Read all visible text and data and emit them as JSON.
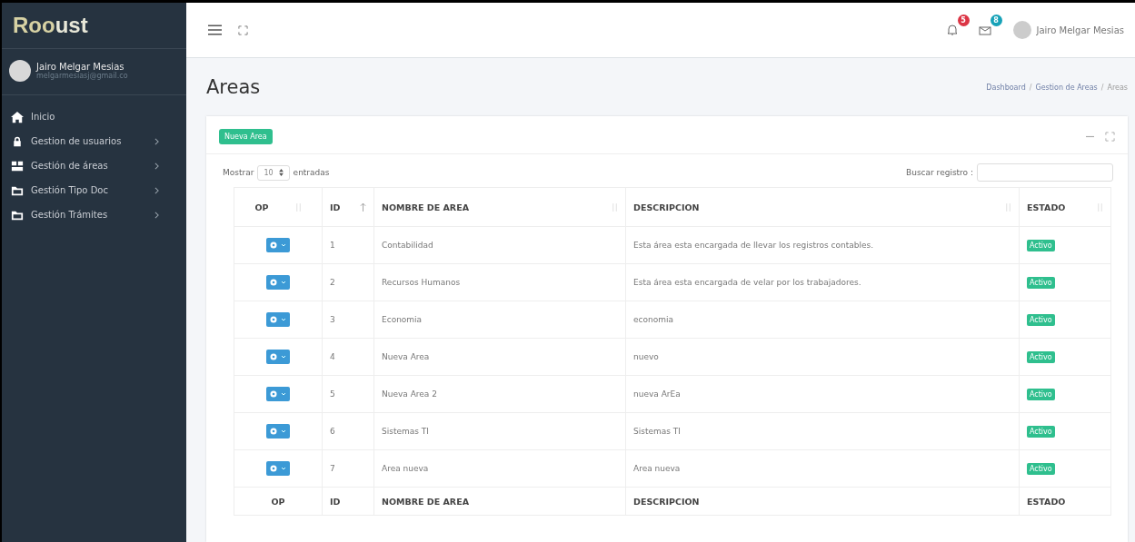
{
  "brand": {
    "logo": "Roo",
    "logo_end": "ust"
  },
  "user": {
    "name": "Jairo Melgar Mesias",
    "email": "melgarmesiasj@gmail.co"
  },
  "sidebar": {
    "items": [
      {
        "label": "Inicio",
        "kind": "home",
        "has_children": false
      },
      {
        "label": "Gestion de usuarios",
        "kind": "lock",
        "has_children": true
      },
      {
        "label": "Gestión de áreas",
        "kind": "boxes",
        "has_children": true
      },
      {
        "label": "Gestión Tipo Doc",
        "kind": "folder",
        "has_children": true
      },
      {
        "label": "Gestión Trámites",
        "kind": "folder",
        "has_children": true
      }
    ]
  },
  "topbar": {
    "notifications": {
      "count": "5",
      "color": "#dc3545"
    },
    "messages": {
      "count": "8",
      "color": "#17a2b8"
    },
    "user_name": "Jairo Melgar Mesias"
  },
  "page": {
    "title": "Areas",
    "breadcrumb": [
      {
        "label": "Dashboard",
        "kind": "link"
      },
      {
        "label": "/",
        "kind": "separator"
      },
      {
        "label": "Gestion de Areas",
        "kind": "link"
      },
      {
        "label": "/",
        "kind": "separator"
      },
      {
        "label": "Areas",
        "kind": "current"
      }
    ]
  },
  "card": {
    "new_button": "Nueva Area",
    "show_label": "Mostrar",
    "page_size": "10",
    "entries_label": "entradas",
    "search_label": "Buscar registro :"
  },
  "table": {
    "columns": [
      {
        "label": "OP",
        "kind": "sortable"
      },
      {
        "label": "ID",
        "kind": "sorted"
      },
      {
        "label": "NOMBRE DE AREA",
        "kind": "sortable"
      },
      {
        "label": "DESCRIPCION",
        "kind": "sortable"
      },
      {
        "label": "ESTADO",
        "kind": "sortable"
      }
    ],
    "rows": [
      {
        "id": "1",
        "name": "Contabilidad",
        "description": "Esta área esta encargada de llevar los registros contables.",
        "status": "Activo"
      },
      {
        "id": "2",
        "name": "Recursos Humanos",
        "description": "Esta área esta encargada de velar por los trabajadores.",
        "status": "Activo"
      },
      {
        "id": "3",
        "name": "Economia",
        "description": "economia",
        "status": "Activo"
      },
      {
        "id": "4",
        "name": "Nueva Area",
        "description": "nuevo",
        "status": "Activo"
      },
      {
        "id": "5",
        "name": "Nueva Area 2",
        "description": "nueva ArEa",
        "status": "Activo"
      },
      {
        "id": "6",
        "name": "Sistemas TI",
        "description": "Sistemas TI",
        "status": "Activo"
      },
      {
        "id": "7",
        "name": "Area nueva",
        "description": "Area nueva",
        "status": "Activo"
      }
    ],
    "footer": [
      "OP",
      "ID",
      "NOMBRE DE AREA",
      "DESCRIPCION",
      "ESTADO"
    ]
  }
}
